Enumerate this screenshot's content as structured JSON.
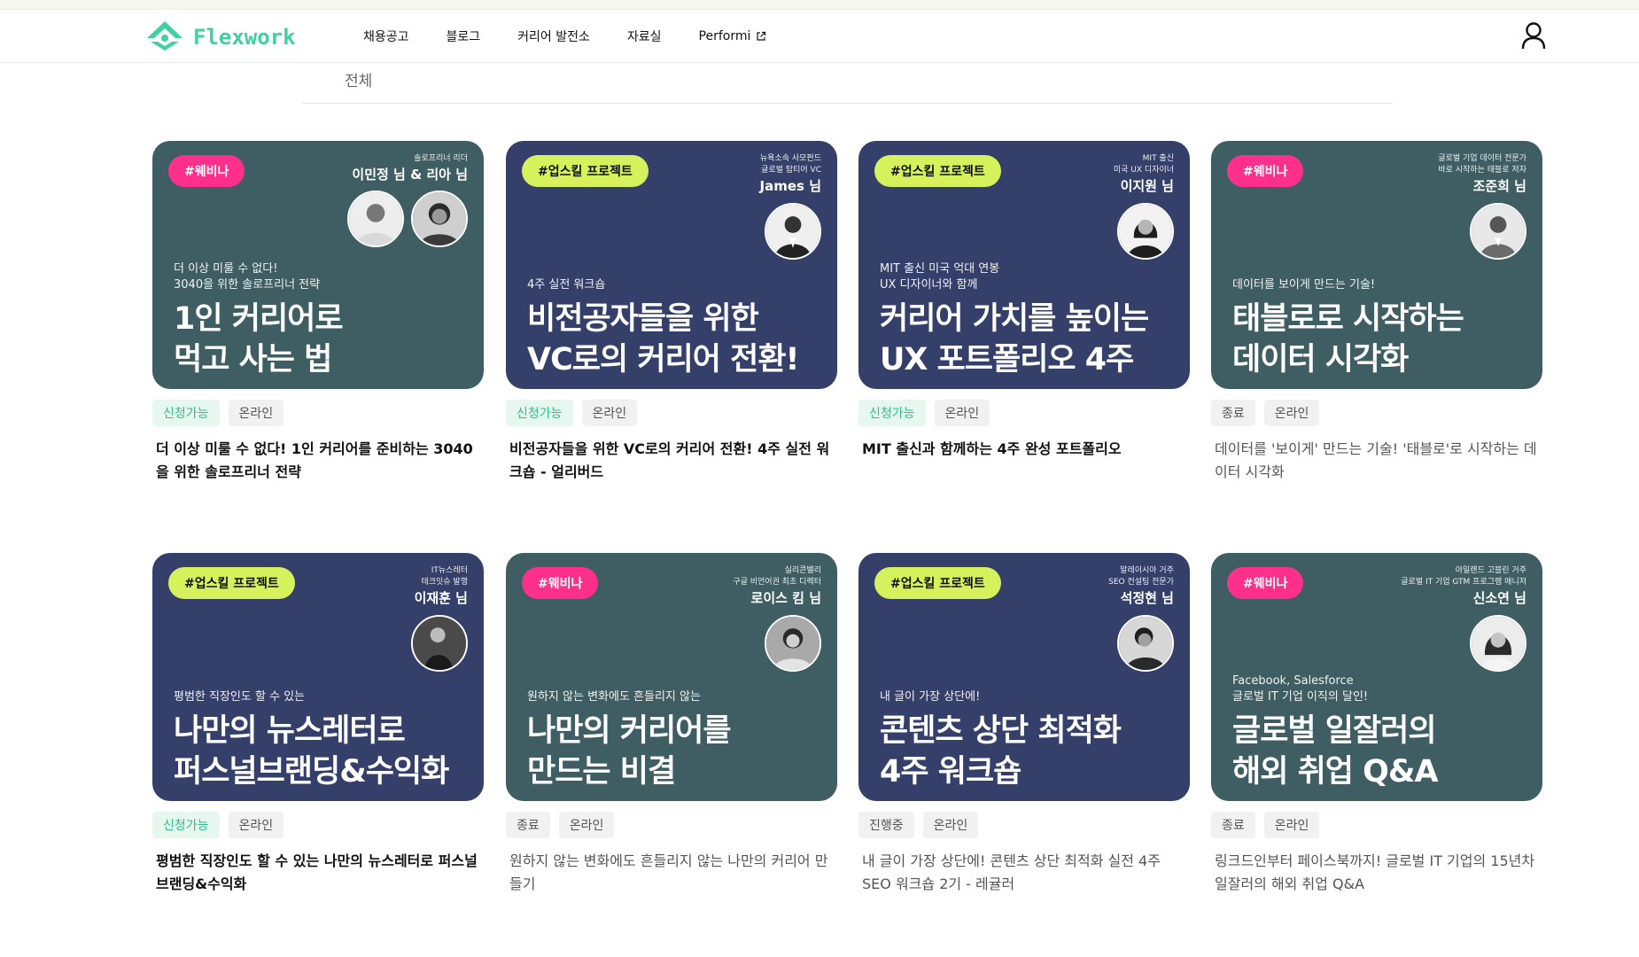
{
  "brand": {
    "name": "Flexwork",
    "accent": "#3fd2a0"
  },
  "nav": {
    "items": [
      {
        "label": "채용공고"
      },
      {
        "label": "블로그"
      },
      {
        "label": "커리어 발전소"
      },
      {
        "label": "자료실"
      },
      {
        "label": "Performi",
        "external": true
      }
    ]
  },
  "icons": {
    "user": "user-icon",
    "external": "external-link-icon",
    "logo": "flexwork-logo-icon"
  },
  "filter": {
    "active_tab": "전체"
  },
  "cards": [
    {
      "badge": "#웨비나",
      "badge_color": "#ff2f8c",
      "bg": "#3f5e63",
      "speaker_sub": [
        "솔로프리너 리더"
      ],
      "speaker_name": "이민정 님 & 리아 님",
      "sub": "더 이상 미룰 수 없다!\n3040을 위한 솔로프리너 전략",
      "title": "1인 커리어로\n먹고 사는 법",
      "status": "신청가능",
      "mode": "온라인",
      "caption": "더 이상 미룰 수 없다! 1인 커리어를 준비하는 3040을 위한 솔로프리너 전략"
    },
    {
      "badge": "#업스킬 프로젝트",
      "badge_color": "#d5f25c",
      "bg": "#34406a",
      "speaker_sub": [
        "뉴욕소속 사모펀드",
        "글로벌 탑티어 VC"
      ],
      "speaker_name": "James 님",
      "sub": "4주 실전 워크숍",
      "title": "비전공자들을 위한\nVC로의 커리어 전환!",
      "status": "신청가능",
      "mode": "온라인",
      "caption": "비전공자들을 위한 VC로의 커리어 전환! 4주 실전 워크숍 - 얼리버드"
    },
    {
      "badge": "#업스킬 프로젝트",
      "badge_color": "#d5f25c",
      "bg": "#34406a",
      "speaker_sub": [
        "MIT 출신",
        "미국 UX 디자이너"
      ],
      "speaker_name": "이지원 님",
      "sub": "MIT 출신 미국 억대 연봉\nUX 디자이너와 함께",
      "title": "커리어 가치를 높이는\nUX 포트폴리오 4주",
      "status": "신청가능",
      "mode": "온라인",
      "caption": "MIT 출신과 함께하는 4주 완성 포트폴리오"
    },
    {
      "badge": "#웨비나",
      "badge_color": "#ff2f8c",
      "bg": "#3f5e63",
      "speaker_sub": [
        "글로벌 기업 데이터 전문가",
        "바로 시작하는 태블로 저자"
      ],
      "speaker_name": "조준희 님",
      "sub": "데이터를 보이게 만드는 기술!",
      "title": "태블로로 시작하는\n데이터 시각화",
      "status": "종료",
      "mode": "온라인",
      "caption": "데이터를 '보이게' 만드는 기술! '태블로'로 시작하는 데이터 시각화"
    },
    {
      "badge": "#업스킬 프로젝트",
      "badge_color": "#d5f25c",
      "bg": "#34406a",
      "speaker_sub": [
        "IT뉴스레터",
        "테크잇슈 발행"
      ],
      "speaker_name": "이재훈 님",
      "sub": "평범한 직장인도 할 수 있는",
      "title": "나만의 뉴스레터로\n퍼스널브랜딩&수익화",
      "status": "신청가능",
      "mode": "온라인",
      "caption": "평범한 직장인도 할 수 있는 나만의 뉴스레터로 퍼스널 브랜딩&수익화"
    },
    {
      "badge": "#웨비나",
      "badge_color": "#ff2f8c",
      "bg": "#3f5e63",
      "speaker_sub": [
        "실리콘밸리",
        "구글 비언어권 최초 디렉터"
      ],
      "speaker_name": "로이스 킴 님",
      "sub": "원하지 않는 변화에도 흔들리지 않는",
      "title": "나만의 커리어를\n만드는 비결",
      "status": "종료",
      "mode": "온라인",
      "caption": "원하지 않는 변화에도 흔들리지 않는 나만의 커리어 만들기"
    },
    {
      "badge": "#업스킬 프로젝트",
      "badge_color": "#d5f25c",
      "bg": "#34406a",
      "speaker_sub": [
        "말레이시아 거주",
        "SEO 컨설팅 전문가"
      ],
      "speaker_name": "석정현 님",
      "sub": "내 글이 가장 상단에!",
      "title": "콘텐츠 상단 최적화\n4주 워크숍",
      "status": "진행중",
      "mode": "온라인",
      "caption": "내 글이 가장 상단에! 콘텐츠 상단 최적화 실전 4주 SEO 워크숍 2기 - 레귤러"
    },
    {
      "badge": "#웨비나",
      "badge_color": "#ff2f8c",
      "bg": "#3f5e63",
      "speaker_sub": [
        "아일랜드 고블린 거주",
        "글로벌 IT 기업 GTM 프로그램 매니저"
      ],
      "speaker_name": "신소연 님",
      "sub": "Facebook, Salesforce\n글로벌 IT 기업 이직의 달인!",
      "title": "글로벌 일잘러의\n해외 취업 Q&A",
      "status": "종료",
      "mode": "온라인",
      "caption": "링크드인부터 페이스북까지! 글로벌 IT 기업의 15년차 일잘러의 해외 취업 Q&A"
    }
  ]
}
